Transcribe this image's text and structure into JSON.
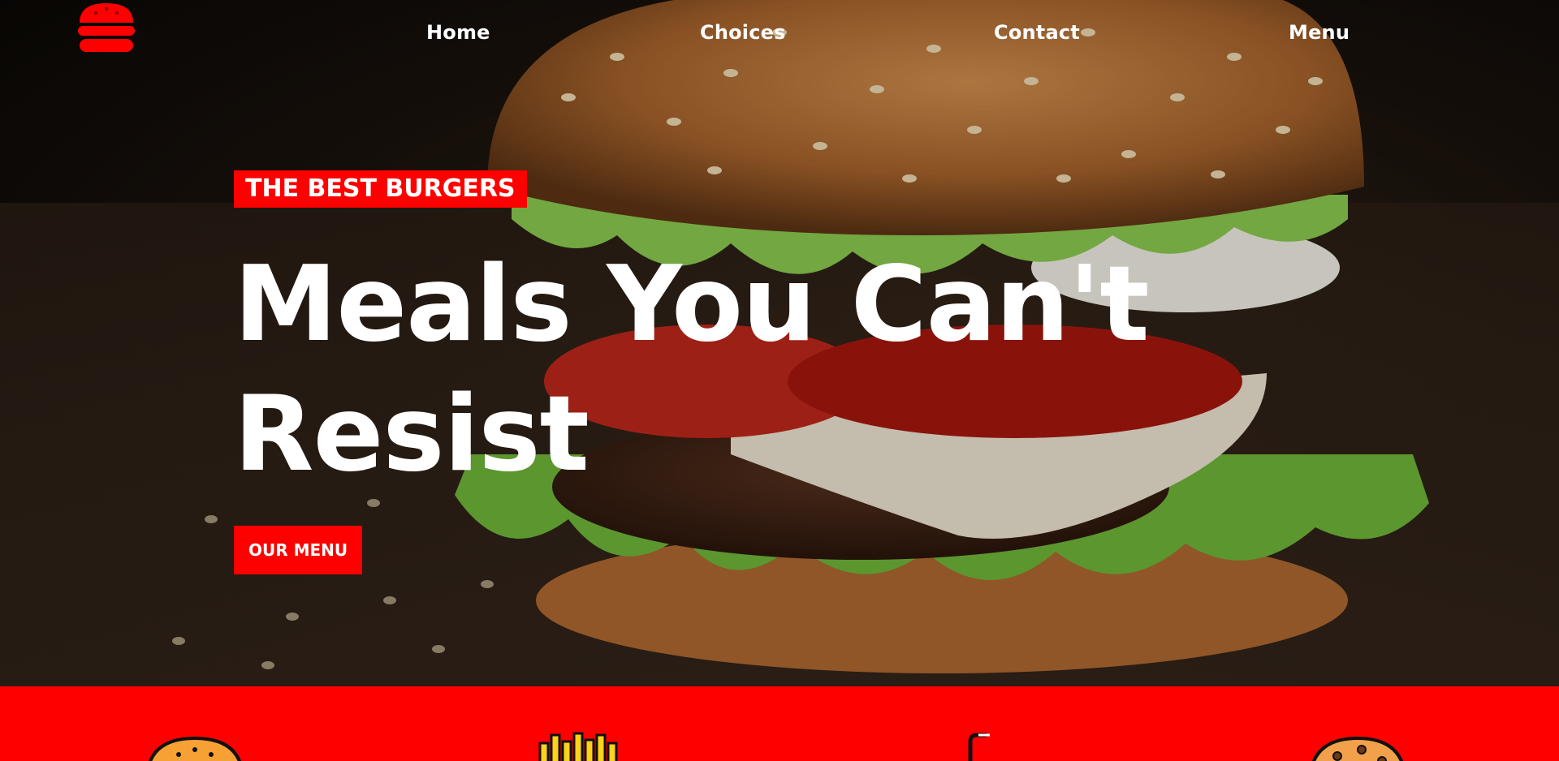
{
  "nav": {
    "logo_icon": "burger-icon",
    "links": [
      {
        "label": "Home"
      },
      {
        "label": "Choices"
      },
      {
        "label": "Contact"
      },
      {
        "label": "Menu"
      }
    ]
  },
  "hero": {
    "tagline": "THE BEST BURGERS",
    "headline": "Meals You Can't Resist",
    "cta_label": "OUR MENU",
    "background_icon": "burger-photo"
  },
  "features": {
    "icons": [
      "burger-icon",
      "fries-icon",
      "drink-icon",
      "cookie-icon"
    ]
  },
  "colors": {
    "accent": "#ff0000",
    "text": "#ffffff"
  }
}
